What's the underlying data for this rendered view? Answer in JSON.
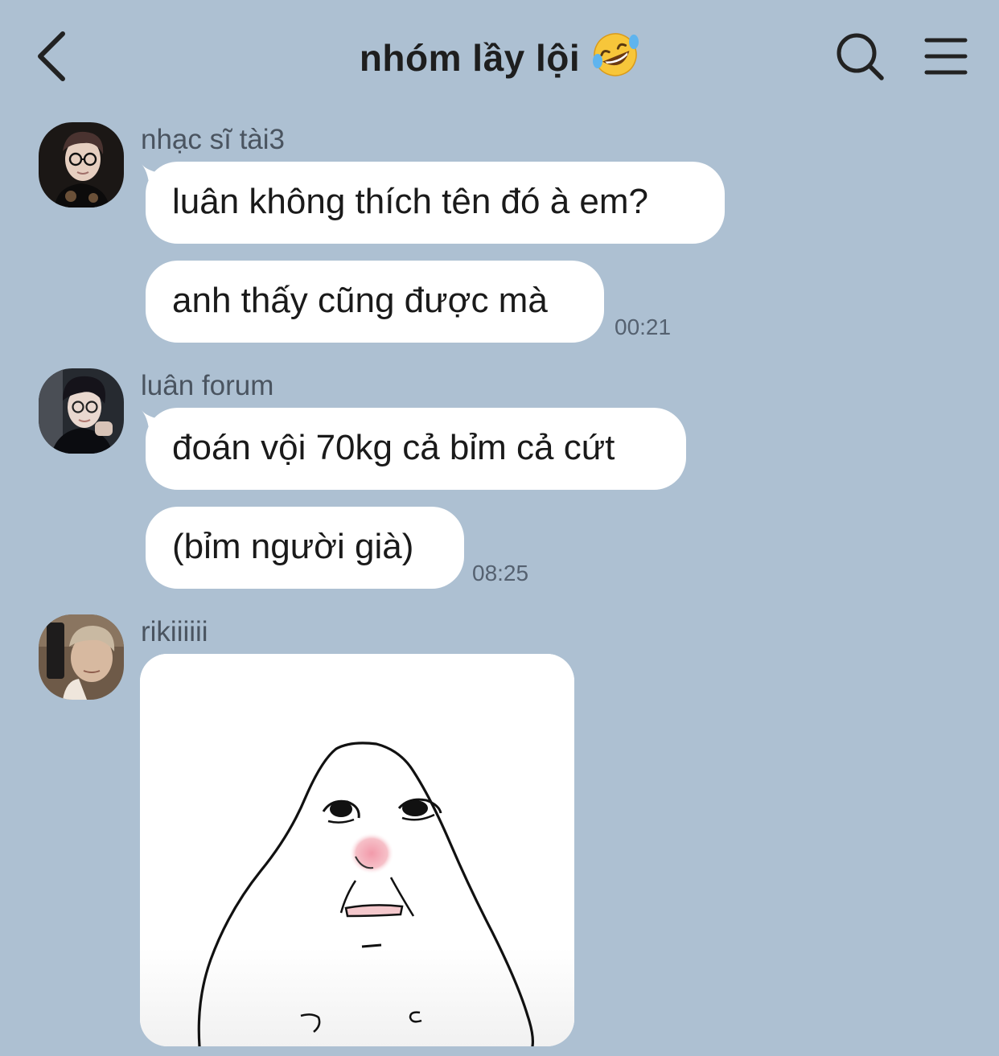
{
  "header": {
    "title": "nhóm lầy lội",
    "back_icon": "chevron-left-icon",
    "search_icon": "search-icon",
    "menu_icon": "hamburger-menu-icon",
    "title_emoji": "rolling-on-floor-laughing-emoji"
  },
  "colors": {
    "background": "#adc0d2",
    "bubble": "#ffffff",
    "text": "#1a1a1a",
    "meta_text": "#556170"
  },
  "messages": [
    {
      "sender": "nhạc sĩ tài3",
      "bubbles": [
        "luân không thích tên đó à em?",
        "anh thấy cũng được mà"
      ],
      "time": "00:21"
    },
    {
      "sender": "luân forum",
      "bubbles": [
        "đoán vội 70kg cả bỉm cả cứt",
        "(bỉm người già)"
      ],
      "time": "08:25"
    },
    {
      "sender": "rikiiiiii",
      "sticker": "blob-face-sticker"
    }
  ]
}
